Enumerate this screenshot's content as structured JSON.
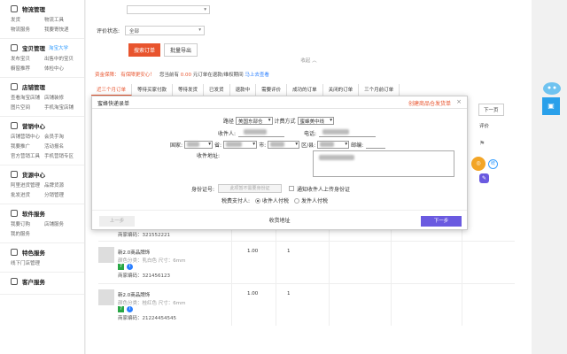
{
  "sidebar": {
    "sections": [
      {
        "title": "物流管理",
        "tag": "",
        "links": [
          "发货",
          "物流工具",
          "物流服务",
          "我要寄快递"
        ]
      },
      {
        "title": "宝贝管理",
        "tag": "淘宝大学",
        "links": [
          "发布宝贝",
          "出售中的宝贝",
          "橱窗推荐",
          "体检中心"
        ]
      },
      {
        "title": "店铺管理",
        "tag": "",
        "links": [
          "查看淘宝店铺",
          "店铺装修",
          "图片空间",
          "手机淘宝店铺"
        ]
      },
      {
        "title": "营销中心",
        "tag": "",
        "links": [
          "店铺营销中心",
          "会员手淘",
          "我要推广",
          "活动报名",
          "官方营销工具",
          "手机营销专区"
        ]
      },
      {
        "title": "货源中心",
        "tag": "",
        "links": [
          "阿里进货管理",
          "品牌货源",
          "批发进货",
          "分销管理"
        ]
      },
      {
        "title": "软件服务",
        "tag": "",
        "links": [
          "我要订购",
          "店铺服务",
          "我的服务"
        ]
      },
      {
        "title": "特色服务",
        "tag": "",
        "links": [
          "线下门店管理"
        ]
      },
      {
        "title": "客户服务",
        "tag": "",
        "links": []
      }
    ]
  },
  "main": {
    "status_label": "评价状态:",
    "status_value": "全部",
    "search_button": "搜索订单",
    "export_button": "批量导出",
    "divider": "收起",
    "notice": {
      "part1": "资金保障：",
      "part2": "有保障更安心！",
      "part3": "您当前有",
      "amount": "0.00",
      "part4": "元订单在退款/维权期间",
      "link": "马上去查看"
    },
    "tabs": [
      "近三个月订单",
      "等待买家付款",
      "等待发货",
      "已发货",
      "退款中",
      "需要评价",
      "成功的订单",
      "关闭的订单",
      "三个月前订单"
    ],
    "right_header": "评价",
    "next_page": "下一页",
    "rows": [
      {
        "name": "",
        "attr": "",
        "code": "商家编码：321552221",
        "price": "",
        "qty": ""
      },
      {
        "name": "新2.0商品牌饰",
        "attr": "颜色分类：乳白色  尺寸：6mm",
        "code": "商家编码：321456123",
        "price": "1.00",
        "qty": "1"
      },
      {
        "name": "新2.0商品牌饰",
        "attr": "颜色分类：桂红色  尺寸：6mm",
        "code": "商家编码：21224454545",
        "price": "1.00",
        "qty": "1"
      }
    ],
    "badge_letter": "7",
    "badge_info": "i"
  },
  "modal": {
    "title": "蜜蜂快递录单",
    "link": "创建商品仓发货单",
    "close": "×",
    "route_label": "路径",
    "route_value": "美国东部仓",
    "billing_label": "计费方式",
    "billing_value": "蜜蜂美中线",
    "receiver_label": "收件人:",
    "phone_label": "电话:",
    "country_label": "国家:",
    "province_label": "省:",
    "city_label": "市:",
    "district_label": "区/县:",
    "zip_label": "邮编:",
    "address_label": "收件地址:",
    "idcard_label": "身份证号:",
    "idcard_placeholder": "此项暂不需要身份证",
    "notify_label": "通知收件人上传身份证",
    "tax_label": "税费支付人:",
    "tax_opt1": "收件人付税",
    "tax_opt2": "发件人付税",
    "prev_button": "上一步",
    "step_label": "收货地址",
    "next_button": "下一步"
  },
  "colors": {
    "accent_red": "#e8542e",
    "purple": "#6a5ae0",
    "blue": "#2a7fff"
  }
}
